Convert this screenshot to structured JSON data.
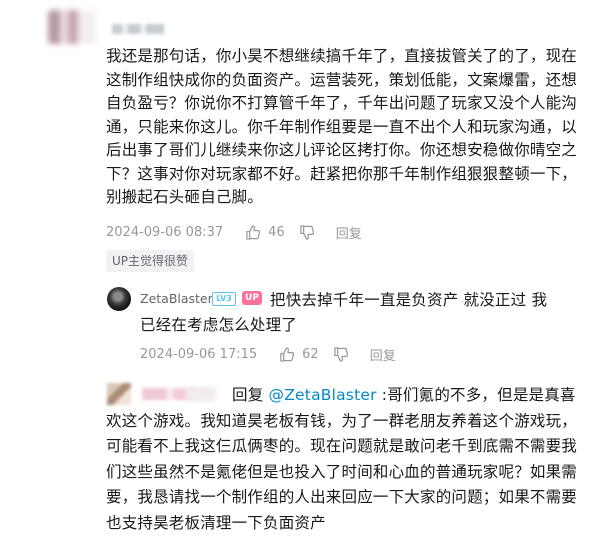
{
  "main_comment": {
    "text": "我还是那句话，你小昊不想继续搞千年了，直接拔管关了的了，现在这制作组快成你的负面资产。运营装死，策划低能，文案爆雷，还想自负盈亏？你说你不打算管千年了，千年出问题了玩家又没个人能沟通，只能来你这儿。你千年制作组要是一直不出个人和玩家沟通，以后出事了哥们儿继续来你这儿评论区拷打你。你还想安稳做你晴空之下？这事对你对玩家都不好。赶紧把你那千年制作组狠狠整顿一下，别搬起石头砸自己脚。",
    "time": "2024-09-06 08:37",
    "likes": "46",
    "reply_label": "回复",
    "up_tag": "UP主觉得很赞"
  },
  "reply1": {
    "username": "ZetaBlaster",
    "level": "LV3",
    "up_badge": "UP",
    "line1": "把快去掉千年一直是负资产 就没正过 我",
    "line2": "已经在考虑怎么处理了",
    "time": "2024-09-06 17:15",
    "likes": "62",
    "reply_label": "回复"
  },
  "reply2": {
    "prefix": "回复 ",
    "mention": "@ZetaBlaster",
    "text": " :哥们氪的不多，但是是真喜欢这个游戏。我知道昊老板有钱，为了一群老朋友养着这个游戏玩，可能看不上我这仨瓜俩枣的。现在问题就是敢问老千到底需不需要我们这些虽然不是氪佬但是也投入了时间和心血的普通玩家呢？如果需要，我恳请找一个制作组的人出来回应一下大家的问题；如果不需要也支持昊老板清理一下负面资产"
  },
  "colors": {
    "text": "#18191c",
    "meta": "#9499a0",
    "link": "#008ac5",
    "up_pink": "#fb7299",
    "level_blue": "#61c3e8"
  },
  "icons": {
    "like": "thumbs-up-icon",
    "dislike": "thumbs-down-icon"
  }
}
